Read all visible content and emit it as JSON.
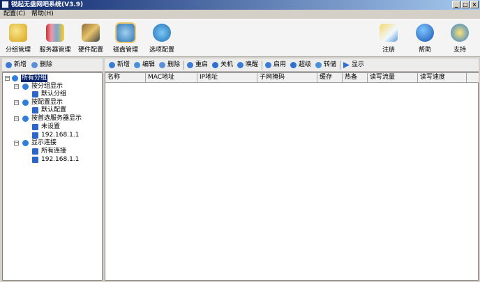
{
  "window": {
    "title": "锐起无盘网吧系统(V3.9)",
    "controls": [
      "_",
      "□",
      "×"
    ]
  },
  "menu": {
    "items": [
      "配置(C)",
      "帮助(H)"
    ]
  },
  "toolbar": {
    "left": [
      {
        "label": "分组管理",
        "icon": "group-icon"
      },
      {
        "label": "服务器管理",
        "icon": "server-icon"
      },
      {
        "label": "硬件配置",
        "icon": "hardware-icon"
      },
      {
        "label": "磁盘管理",
        "icon": "disk-icon"
      },
      {
        "label": "选项配置",
        "icon": "options-icon"
      }
    ],
    "right": [
      {
        "label": "注册",
        "icon": "register-icon"
      },
      {
        "label": "帮助",
        "icon": "help-icon"
      },
      {
        "label": "支持",
        "icon": "support-icon"
      }
    ]
  },
  "left_toolbar": {
    "new": "新增",
    "delete": "删除"
  },
  "right_toolbar": {
    "buttons": [
      "新增",
      "编辑",
      "删除",
      "重启",
      "关机",
      "唤醒",
      "启用",
      "超级",
      "转储",
      "显示"
    ]
  },
  "tree": {
    "root": "所有分组",
    "groups": [
      {
        "label": "按分组显示",
        "children": [
          "默认分组"
        ]
      },
      {
        "label": "按配置显示",
        "children": [
          "默认配置"
        ]
      },
      {
        "label": "按首选服务器显示",
        "children": [
          "未设置",
          "192.168.1.1"
        ]
      },
      {
        "label": "显示连接",
        "children": [
          "所有连接",
          "192.168.1.1"
        ]
      }
    ]
  },
  "table": {
    "columns": [
      "名称",
      "MAC地址",
      "IP地址",
      "子网掩码",
      "缓存",
      "热备",
      "读写流量",
      "读写速度"
    ]
  },
  "colors": {
    "titlebar_start": "#0a246a",
    "titlebar_end": "#a6caf0",
    "selection": "#0a246a"
  }
}
